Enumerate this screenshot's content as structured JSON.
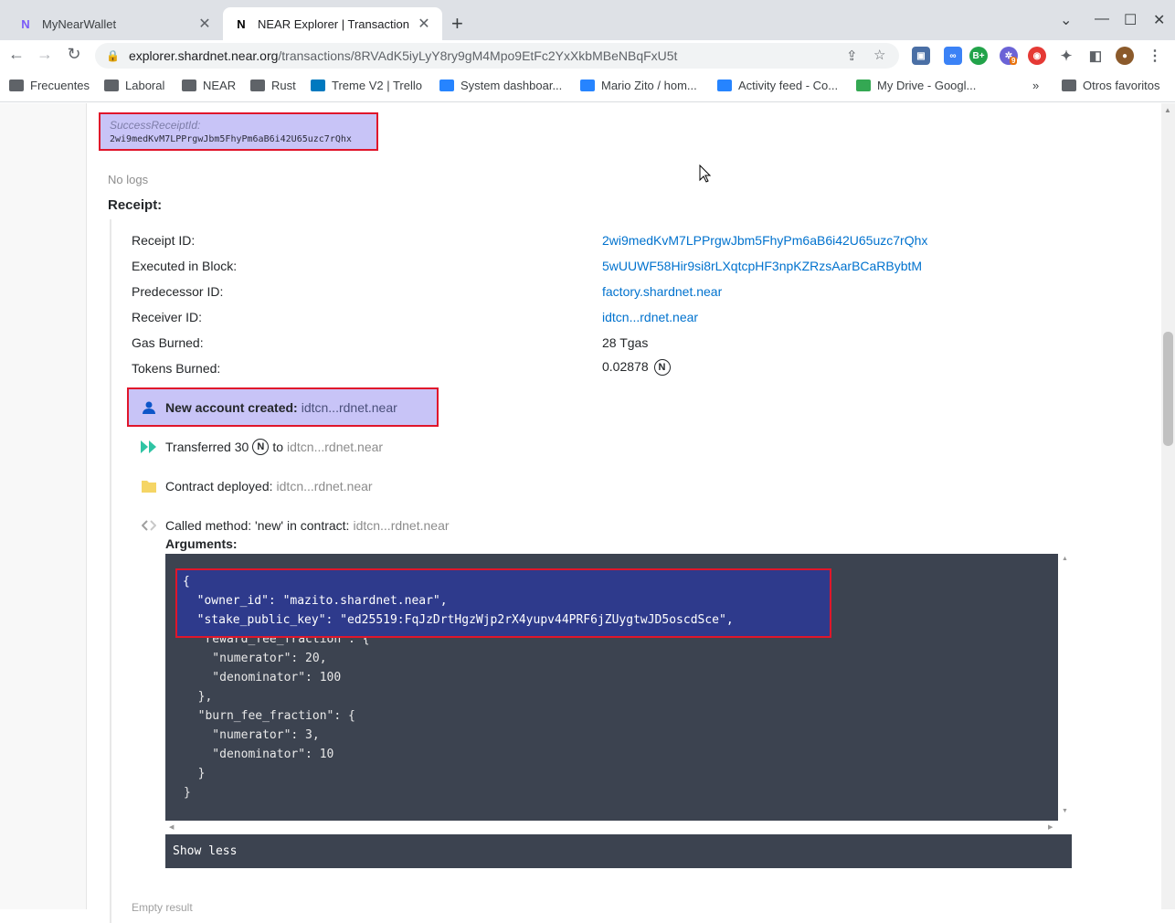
{
  "tabs": [
    {
      "title": "MyNearWallet"
    },
    {
      "title": "NEAR Explorer | Transaction"
    }
  ],
  "url": {
    "host": "explorer.shardnet.near.org",
    "path": "/transactions/8RVAdK5iyLyY8ry9gM4Mpo9EtFc2YxXkbMBeNBqFxU5t"
  },
  "extensions": {
    "badge_count": "9",
    "badge_label": "B+"
  },
  "bookmarks": [
    {
      "label": "Frecuentes"
    },
    {
      "label": "Laboral"
    },
    {
      "label": "NEAR"
    },
    {
      "label": "Rust"
    },
    {
      "label": "Treme V2 | Trello"
    },
    {
      "label": "System dashboar..."
    },
    {
      "label": "Mario Zito / hom..."
    },
    {
      "label": "Activity feed - Co..."
    },
    {
      "label": "My Drive - Googl..."
    },
    {
      "label": "Otros favoritos"
    }
  ],
  "outcome": {
    "success_label": "SuccessReceiptId:",
    "success_value": "2wi9medKvM7LPPrgwJbm5FhyPm6aB6i42U65uzc7rQhx",
    "logs": "No logs"
  },
  "receipt": {
    "heading": "Receipt:",
    "rows": [
      {
        "label": "Receipt ID:",
        "value": "2wi9medKvM7LPPrgwJbm5FhyPm6aB6i42U65uzc7rQhx"
      },
      {
        "label": "Executed in Block:",
        "value": "5wUUWF58Hir9si8rLXqtcpHF3npKZRzsAarBCaRBybtM"
      },
      {
        "label": "Predecessor ID:",
        "value": "factory.shardnet.near"
      },
      {
        "label": "Receiver ID:",
        "value": "idtcn...rdnet.near"
      },
      {
        "label": "Gas Burned:",
        "value": "28 Tgas"
      },
      {
        "label": "Tokens Burned:",
        "value": "0.02878"
      }
    ],
    "near_symbol": "N"
  },
  "actions": {
    "new_account_label": "New account created:",
    "new_account_addr": "idtcn...rdnet.near",
    "transfer_prefix": "Transferred 30",
    "transfer_to": "to",
    "transfer_addr": "idtcn...rdnet.near",
    "deploy_label": "Contract deployed:",
    "deploy_addr": "idtcn...rdnet.near",
    "call_label": "Called method: 'new' in contract:",
    "call_addr": "idtcn...rdnet.near",
    "args_label": "Arguments:"
  },
  "arguments_code": "{\n  \"owner_id\": \"mazito.shardnet.near\",\n  \"stake_public_key\": \"ed25519:FqJzDrtHgzWjp2rX4yupv44PRF6jZUygtwJD5oscdSce\",\n  \"reward_fee_fraction\": {\n    \"numerator\": 20,\n    \"denominator\": 100\n  },\n  \"burn_fee_fraction\": {\n    \"numerator\": 3,\n    \"denominator\": 10\n  }\n}",
  "arguments_highlight": "{\n  \"owner_id\": \"mazito.shardnet.near\",\n  \"stake_public_key\": \"ed25519:FqJzDrtHgzWjp2rX4yupv44PRF6jZUygtwJD5oscdSce\",",
  "show_less": "Show less",
  "empty_result": "Empty result"
}
